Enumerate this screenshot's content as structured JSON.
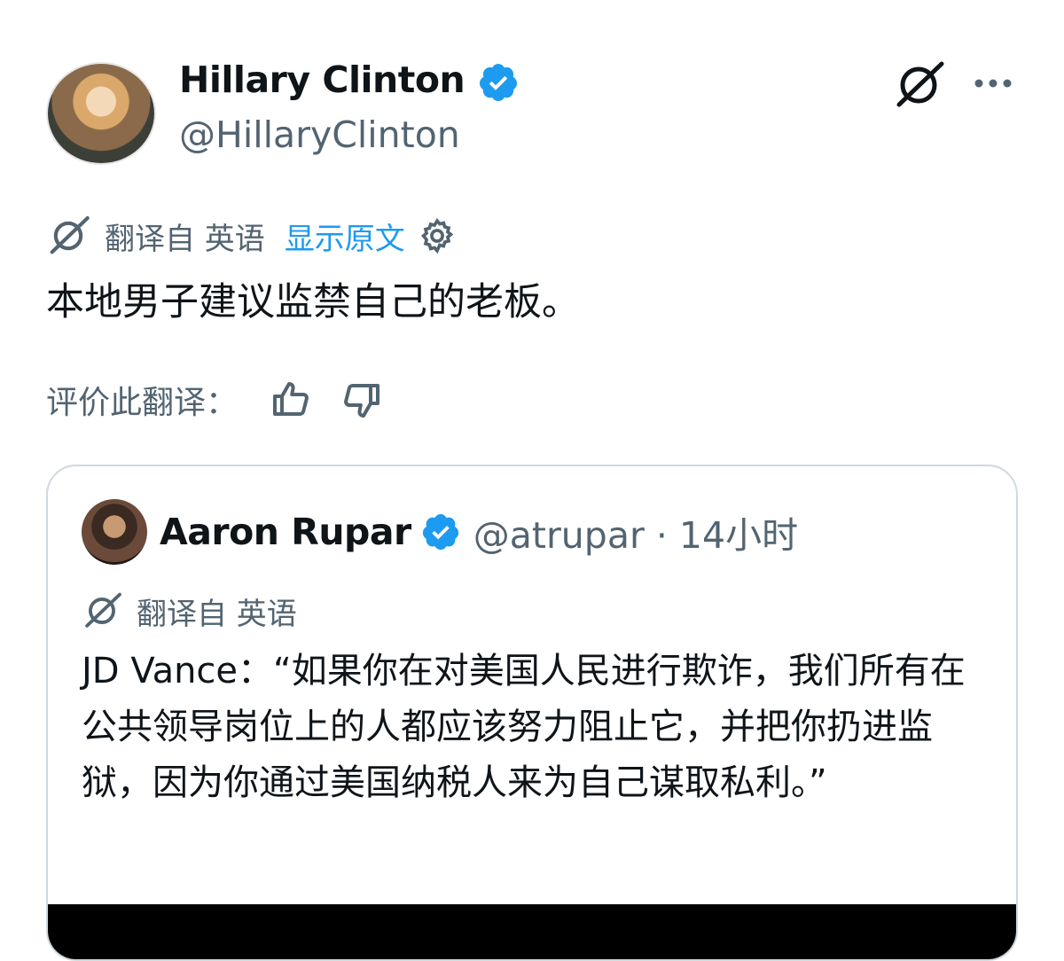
{
  "tweet": {
    "author_name": "Hillary Clinton",
    "author_handle": "@HillaryClinton",
    "translated_from": "翻译自 英语",
    "show_original": "显示原文",
    "text": "本地男子建议监禁自己的老板。",
    "rate_label": "评价此翻译："
  },
  "quote": {
    "author_name": "Aaron Rupar",
    "author_handle": "@atrupar · 14小时",
    "translated_from": "翻译自 英语",
    "text": "JD Vance：“如果你在对美国人民进行欺诈，我们所有在公共领导岗位上的人都应该努力阻止它，并把你扔进监狱，因为你通过美国纳税人来为自己谋取私利。”"
  },
  "colors": {
    "accent": "#1d9bf0",
    "secondary_text": "#536471",
    "border": "#cfd9de"
  }
}
